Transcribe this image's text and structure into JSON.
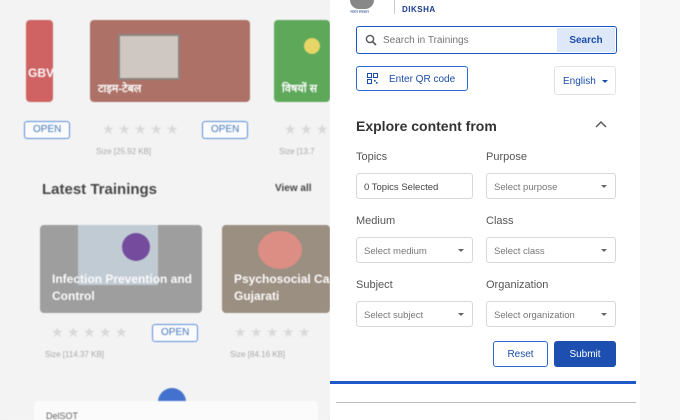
{
  "background": {
    "top_cards": [
      {
        "title": "GBV",
        "color": "#c94444"
      },
      {
        "title": "टाइम-टेबल",
        "color": "#a0574a"
      },
      {
        "title": "विषयों स",
        "color": "#3f9a3b"
      }
    ],
    "top_open_label": "OPEN",
    "top_sizes": [
      "Size [25.92 KB]",
      "Size [13.7"
    ],
    "latest_title": "Latest Trainings",
    "view_all": "View all",
    "mid_cards": [
      {
        "title": "Infection Prevention and Control",
        "open": "OPEN",
        "size": "Size [114.37 KB]"
      },
      {
        "title": "Psychosocial Ca Gujarati",
        "size": "Size [84.16 KB]"
      }
    ],
    "bottom_card_text": "DelSOT"
  },
  "header": {
    "emblem_caption": "भारत सरकार",
    "brand": "DIKSHA"
  },
  "search": {
    "placeholder": "Search in Trainings",
    "button": "Search"
  },
  "qr_button": "Enter QR code",
  "language": {
    "selected": "English"
  },
  "filters": {
    "title": "Explore content from",
    "topics_label": "Topics",
    "topics_value": "0 Topics Selected",
    "purpose_label": "Purpose",
    "purpose_placeholder": "Select purpose",
    "medium_label": "Medium",
    "medium_placeholder": "Select medium",
    "class_label": "Class",
    "class_placeholder": "Select class",
    "subject_label": "Subject",
    "subject_placeholder": "Select subject",
    "organization_label": "Organization",
    "organization_placeholder": "Select organization",
    "reset": "Reset",
    "submit": "Submit"
  },
  "colors": {
    "primary": "#1d4fb0",
    "accent_border": "#2d6bd2"
  }
}
